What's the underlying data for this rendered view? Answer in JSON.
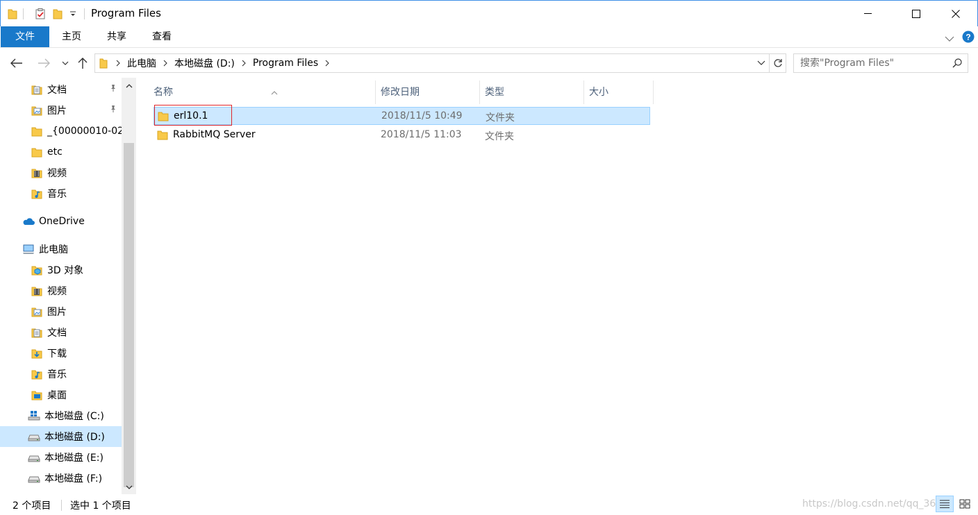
{
  "window": {
    "title": "Program Files"
  },
  "ribbon": {
    "tabs": [
      "文件",
      "主页",
      "共享",
      "查看"
    ]
  },
  "address": {
    "crumbs": [
      "此电脑",
      "本地磁盘 (D:)",
      "Program Files"
    ],
    "search_placeholder": "搜索\"Program Files\""
  },
  "sidebar": {
    "items": [
      {
        "label": "文档",
        "icon": "documents-icon",
        "pinned": true
      },
      {
        "label": "图片",
        "icon": "pictures-icon",
        "pinned": true
      },
      {
        "label": "_{00000010-02",
        "icon": "folder-icon",
        "pinned": false
      },
      {
        "label": "etc",
        "icon": "folder-icon",
        "pinned": false
      },
      {
        "label": "视频",
        "icon": "videos-icon",
        "pinned": false
      },
      {
        "label": "音乐",
        "icon": "music-icon",
        "pinned": false
      },
      {
        "label": "OneDrive",
        "icon": "onedrive-icon",
        "pinned": false
      },
      {
        "label": "此电脑",
        "icon": "this-pc-icon",
        "pinned": false
      },
      {
        "label": "3D 对象",
        "icon": "3d-objects-icon",
        "pinned": false
      },
      {
        "label": "视频",
        "icon": "videos-icon",
        "pinned": false
      },
      {
        "label": "图片",
        "icon": "pictures-icon",
        "pinned": false
      },
      {
        "label": "文档",
        "icon": "documents-icon",
        "pinned": false
      },
      {
        "label": "下载",
        "icon": "downloads-icon",
        "pinned": false
      },
      {
        "label": "音乐",
        "icon": "music-icon",
        "pinned": false
      },
      {
        "label": "桌面",
        "icon": "desktop-icon",
        "pinned": false
      },
      {
        "label": "本地磁盘 (C:)",
        "icon": "system-drive-icon",
        "pinned": false
      },
      {
        "label": "本地磁盘 (D:)",
        "icon": "drive-icon",
        "pinned": false,
        "selected": true
      },
      {
        "label": "本地磁盘 (E:)",
        "icon": "drive-icon",
        "pinned": false
      },
      {
        "label": "本地磁盘 (F:)",
        "icon": "drive-icon",
        "pinned": false
      }
    ]
  },
  "list": {
    "columns": [
      "名称",
      "修改日期",
      "类型",
      "大小"
    ],
    "rows": [
      {
        "name": "erl10.1",
        "date": "2018/11/5 10:49",
        "type": "文件夹",
        "size": "",
        "selected": true
      },
      {
        "name": "RabbitMQ Server",
        "date": "2018/11/5 11:03",
        "type": "文件夹",
        "size": "",
        "selected": false
      }
    ]
  },
  "status": {
    "count": "2 个项目",
    "selection": "选中 1 个项目",
    "watermark": "https://blog.csdn.net/qq_36"
  },
  "colors": {
    "accent": "#1979ca",
    "selection": "#cce8ff",
    "highlight_box": "#e0262b"
  }
}
